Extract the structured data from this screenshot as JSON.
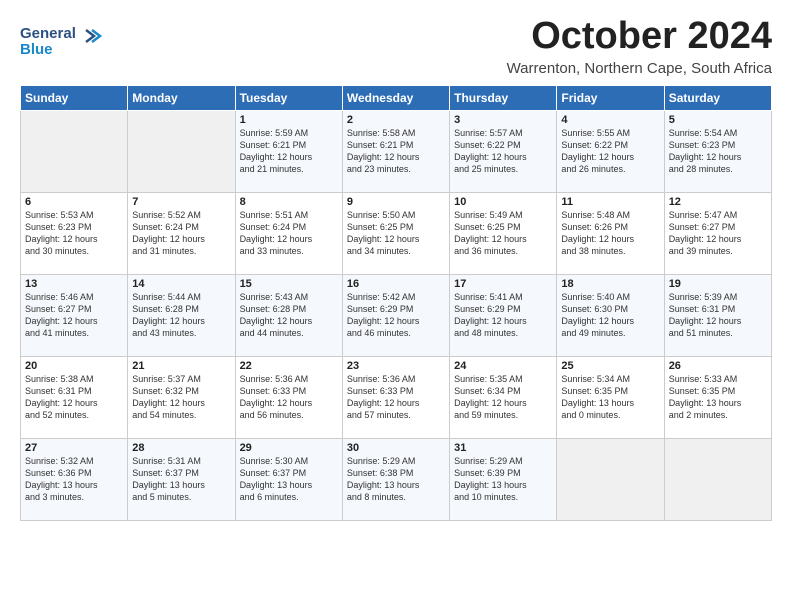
{
  "logo": {
    "line1": "General",
    "line2": "Blue"
  },
  "title": "October 2024",
  "subtitle": "Warrenton, Northern Cape, South Africa",
  "weekdays": [
    "Sunday",
    "Monday",
    "Tuesday",
    "Wednesday",
    "Thursday",
    "Friday",
    "Saturday"
  ],
  "weeks": [
    [
      {
        "day": "",
        "detail": ""
      },
      {
        "day": "",
        "detail": ""
      },
      {
        "day": "1",
        "detail": "Sunrise: 5:59 AM\nSunset: 6:21 PM\nDaylight: 12 hours\nand 21 minutes."
      },
      {
        "day": "2",
        "detail": "Sunrise: 5:58 AM\nSunset: 6:21 PM\nDaylight: 12 hours\nand 23 minutes."
      },
      {
        "day": "3",
        "detail": "Sunrise: 5:57 AM\nSunset: 6:22 PM\nDaylight: 12 hours\nand 25 minutes."
      },
      {
        "day": "4",
        "detail": "Sunrise: 5:55 AM\nSunset: 6:22 PM\nDaylight: 12 hours\nand 26 minutes."
      },
      {
        "day": "5",
        "detail": "Sunrise: 5:54 AM\nSunset: 6:23 PM\nDaylight: 12 hours\nand 28 minutes."
      }
    ],
    [
      {
        "day": "6",
        "detail": "Sunrise: 5:53 AM\nSunset: 6:23 PM\nDaylight: 12 hours\nand 30 minutes."
      },
      {
        "day": "7",
        "detail": "Sunrise: 5:52 AM\nSunset: 6:24 PM\nDaylight: 12 hours\nand 31 minutes."
      },
      {
        "day": "8",
        "detail": "Sunrise: 5:51 AM\nSunset: 6:24 PM\nDaylight: 12 hours\nand 33 minutes."
      },
      {
        "day": "9",
        "detail": "Sunrise: 5:50 AM\nSunset: 6:25 PM\nDaylight: 12 hours\nand 34 minutes."
      },
      {
        "day": "10",
        "detail": "Sunrise: 5:49 AM\nSunset: 6:25 PM\nDaylight: 12 hours\nand 36 minutes."
      },
      {
        "day": "11",
        "detail": "Sunrise: 5:48 AM\nSunset: 6:26 PM\nDaylight: 12 hours\nand 38 minutes."
      },
      {
        "day": "12",
        "detail": "Sunrise: 5:47 AM\nSunset: 6:27 PM\nDaylight: 12 hours\nand 39 minutes."
      }
    ],
    [
      {
        "day": "13",
        "detail": "Sunrise: 5:46 AM\nSunset: 6:27 PM\nDaylight: 12 hours\nand 41 minutes."
      },
      {
        "day": "14",
        "detail": "Sunrise: 5:44 AM\nSunset: 6:28 PM\nDaylight: 12 hours\nand 43 minutes."
      },
      {
        "day": "15",
        "detail": "Sunrise: 5:43 AM\nSunset: 6:28 PM\nDaylight: 12 hours\nand 44 minutes."
      },
      {
        "day": "16",
        "detail": "Sunrise: 5:42 AM\nSunset: 6:29 PM\nDaylight: 12 hours\nand 46 minutes."
      },
      {
        "day": "17",
        "detail": "Sunrise: 5:41 AM\nSunset: 6:29 PM\nDaylight: 12 hours\nand 48 minutes."
      },
      {
        "day": "18",
        "detail": "Sunrise: 5:40 AM\nSunset: 6:30 PM\nDaylight: 12 hours\nand 49 minutes."
      },
      {
        "day": "19",
        "detail": "Sunrise: 5:39 AM\nSunset: 6:31 PM\nDaylight: 12 hours\nand 51 minutes."
      }
    ],
    [
      {
        "day": "20",
        "detail": "Sunrise: 5:38 AM\nSunset: 6:31 PM\nDaylight: 12 hours\nand 52 minutes."
      },
      {
        "day": "21",
        "detail": "Sunrise: 5:37 AM\nSunset: 6:32 PM\nDaylight: 12 hours\nand 54 minutes."
      },
      {
        "day": "22",
        "detail": "Sunrise: 5:36 AM\nSunset: 6:33 PM\nDaylight: 12 hours\nand 56 minutes."
      },
      {
        "day": "23",
        "detail": "Sunrise: 5:36 AM\nSunset: 6:33 PM\nDaylight: 12 hours\nand 57 minutes."
      },
      {
        "day": "24",
        "detail": "Sunrise: 5:35 AM\nSunset: 6:34 PM\nDaylight: 12 hours\nand 59 minutes."
      },
      {
        "day": "25",
        "detail": "Sunrise: 5:34 AM\nSunset: 6:35 PM\nDaylight: 13 hours\nand 0 minutes."
      },
      {
        "day": "26",
        "detail": "Sunrise: 5:33 AM\nSunset: 6:35 PM\nDaylight: 13 hours\nand 2 minutes."
      }
    ],
    [
      {
        "day": "27",
        "detail": "Sunrise: 5:32 AM\nSunset: 6:36 PM\nDaylight: 13 hours\nand 3 minutes."
      },
      {
        "day": "28",
        "detail": "Sunrise: 5:31 AM\nSunset: 6:37 PM\nDaylight: 13 hours\nand 5 minutes."
      },
      {
        "day": "29",
        "detail": "Sunrise: 5:30 AM\nSunset: 6:37 PM\nDaylight: 13 hours\nand 6 minutes."
      },
      {
        "day": "30",
        "detail": "Sunrise: 5:29 AM\nSunset: 6:38 PM\nDaylight: 13 hours\nand 8 minutes."
      },
      {
        "day": "31",
        "detail": "Sunrise: 5:29 AM\nSunset: 6:39 PM\nDaylight: 13 hours\nand 10 minutes."
      },
      {
        "day": "",
        "detail": ""
      },
      {
        "day": "",
        "detail": ""
      }
    ]
  ]
}
